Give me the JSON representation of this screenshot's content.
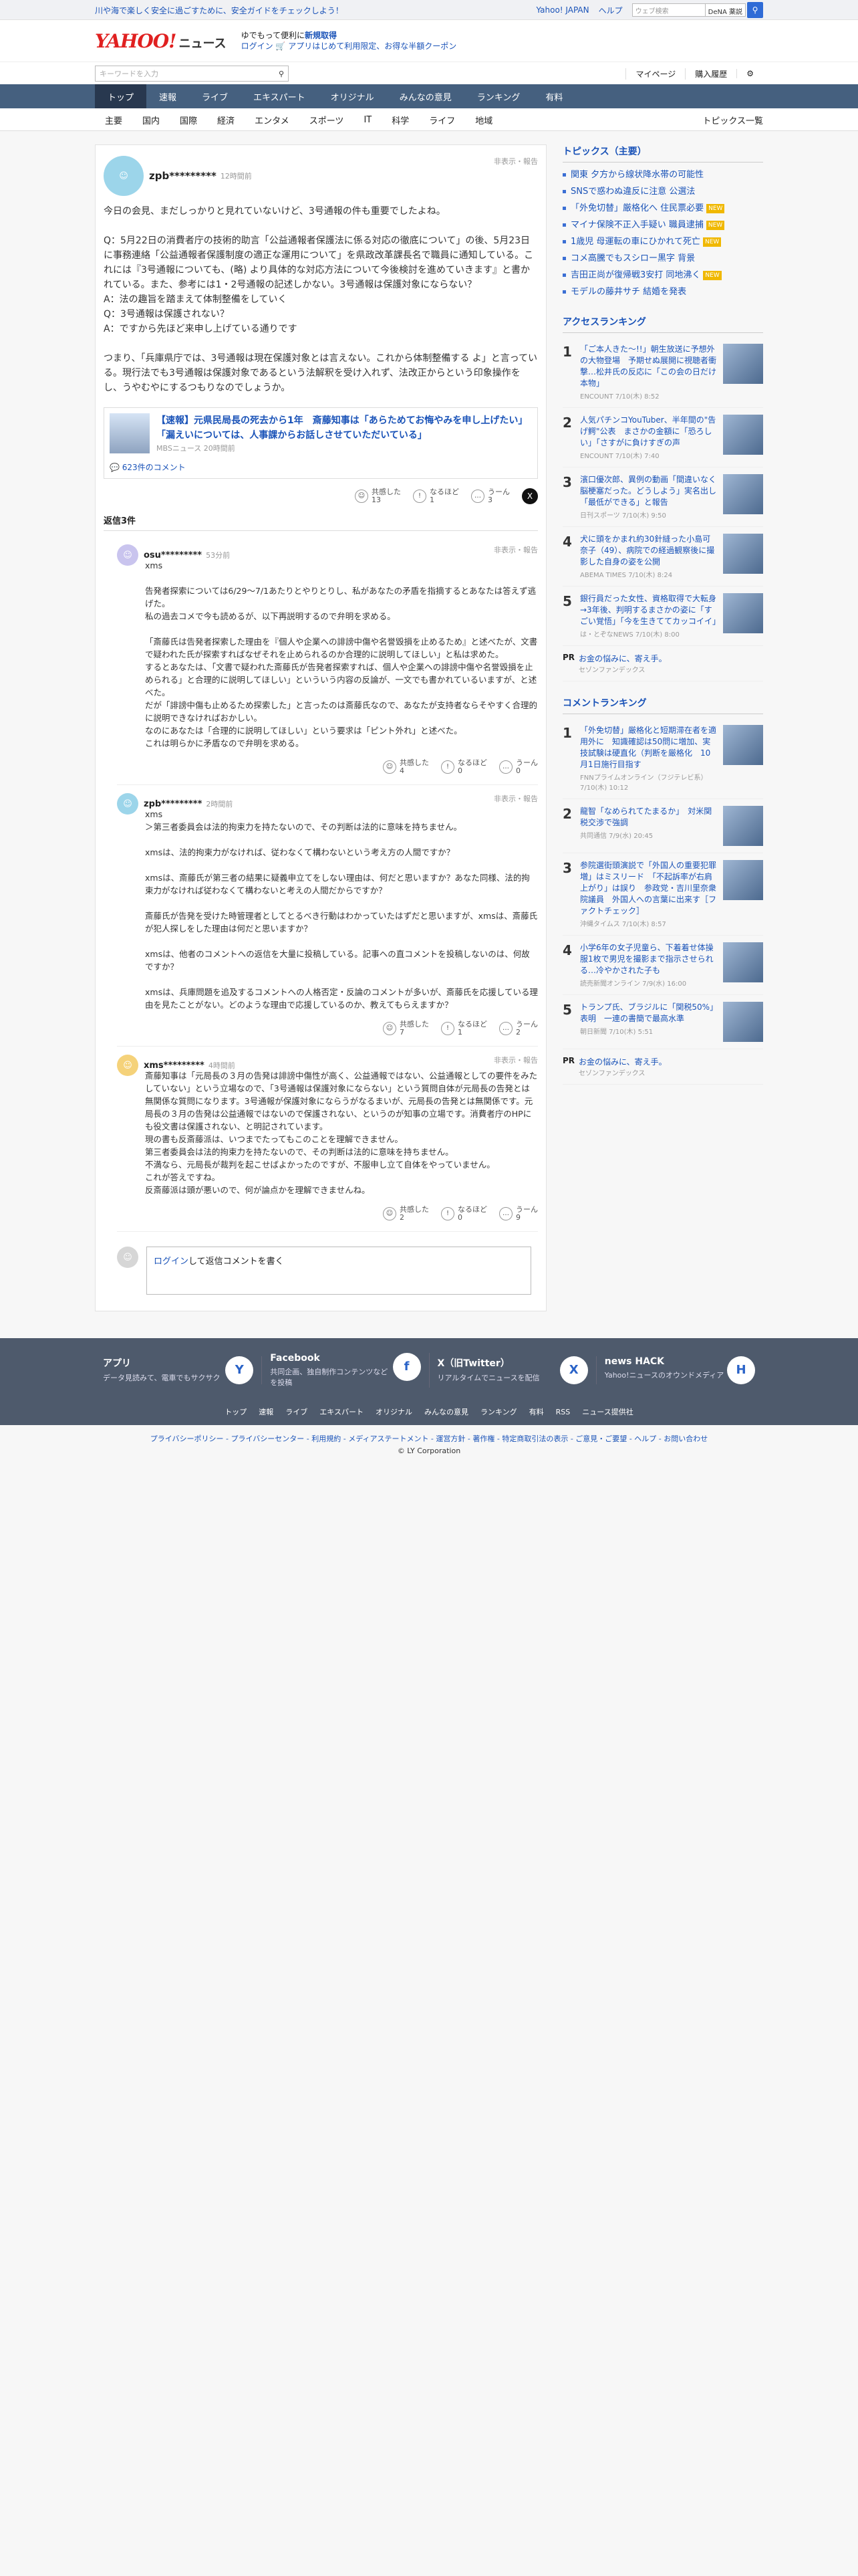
{
  "topstrip": {
    "notice": "川や海で楽しく安全に過ごすために、安全ガイドをチェックしよう！",
    "links": [
      "Yahoo! JAPAN",
      "ヘルプ"
    ],
    "search_placeholder": "ウェブ検索",
    "dena": "DeNA 薬説"
  },
  "header": {
    "logo_yahoo": "YAHOO!",
    "logo_japan": "JAPAN",
    "logo_news": "ニュース",
    "promo1": "ゆでもって便利に",
    "promo1_bold": "新規取得",
    "promo2": "ログイン",
    "promo3": "アプリはじめて利用限定、お得な半額クーポン"
  },
  "search": {
    "placeholder": "キーワードを入力",
    "mypage": "マイページ",
    "history": "購入履歴"
  },
  "gnav": [
    "トップ",
    "速報",
    "ライブ",
    "エキスパート",
    "オリジナル",
    "みんなの意見",
    "ランキング",
    "有料"
  ],
  "snav": [
    "主要",
    "国内",
    "国際",
    "経済",
    "エンタメ",
    "スポーツ",
    "IT",
    "科学",
    "ライフ",
    "地域"
  ],
  "snav_all": "トピックス一覧",
  "comment": {
    "user": "zpb*********",
    "time": "12時間前",
    "report": "非表示・報告",
    "text": "今日の会見、まだしっかりと見れていないけど、3号通報の件も重要でしたよね。\n\nQ：5月22日の消費者庁の技術的助言「公益通報者保護法に係る対応の徹底について」の後、5月23日に事務連絡「公益通報者保護制度の適正な運用について」を県政改革課長名で職員に通知している。これには『3号通報についても、(略) より具体的な対応方法について今後検討を進めていきます』と書かれている。また、参考には1・2号通報の記述しかない。3号通報は保護対象にならない？\nA：法の趣旨を踏まえて体制整備をしていく\nQ：3号通報は保護されない？\nA：ですから先ほど来申し上げている通りです\n\nつまり、「兵庫県庁では、3号通報は現在保護対象とは言えない。これから体制整備する よ」と言っている。現行法でも3号通報は保護対象であるという法解釈を受け入れず、法改正からという印象操作をし、うやむやにするつもりなのでしょうか。",
    "article_title": "【速報】元県民局長の死去から1年　斎藤知事は「あらためてお悔やみを申し上げたい」「漏えいについては、人事課からお話しさせていただいている」",
    "article_meta": "MBSニュース 20時間前",
    "article_comments": "623件のコメント",
    "reacts": {
      "empathy_label": "共感した",
      "empathy": "13",
      "naruhodo_label": "なるほど",
      "naruhodo": "1",
      "uun_label": "うーん",
      "uun": "3"
    }
  },
  "replies_label": "返信3件",
  "replies": [
    {
      "user": "osu*********",
      "time": "53分前",
      "report": "非表示・報告",
      "text": "xms\n\n告発者探索については6/29〜7/1あたりとやりとりし、私があなたの矛盾を指摘するとあなたは答えず逃げた。\n私の過去コメで今も読めるが、以下再説明するので弁明を求める。\n\n「斎藤氏は告発者探索した理由を『個人や企業への誹謗中傷や名誉毀損を止めるため』と述べたが、文書で疑われた氏が探索すればなぜそれを止められるのか合理的に説明してほしい」と私は求めた。\nするとあなたは、「文書で疑われた斎藤氏が告発者探索すれば、個人や企業への誹謗中傷や名誉毀損を止められる」と合理的に説明してほしい」といういう内容の反論が、一文でも書かれているいますが、と述べた。\nだが「誹謗中傷も止めるため探索した」と言ったのは斎藤氏なので、あなたが支持者ならそやすく合理的に説明できなければおかしい。\nなのにあなたは「合理的に説明してほしい」という要求は「ピント外れ」と述べた。\nこれは明らかに矛盾なので弁明を求める。",
      "empathy": "4",
      "naruhodo": "0",
      "uun": "0"
    },
    {
      "user": "zpb*********",
      "time": "2時間前",
      "report": "非表示・報告",
      "text": "xms\n＞第三者委員会は法的拘束力を持たないので、その判断は法的に意味を持ちません。\n\nxmsは、法的拘束力がなければ、従わなくて構わないという考え方の人間ですか？\n\nxmsは、斎藤氏が第三者の結果に疑義申立てをしない理由は、何だと思いますか？あなた同様、法的拘束力がなければ従わなくて構わないと考えの人間だからですか？\n\n斎藤氏が告発を受けた時管理者としてとるべき行動はわかっていたはずだと思いますが、xmsは、斎藤氏が犯人探しをした理由は何だと思いますか？\n\nxmsは、他者のコメントへの返信を大量に投稿している。記事への直コメントを投稿しないのは、何故ですか？\n\nxmsは、兵庫問題を追及するコメントへの人格否定・反論のコメントが多いが、斎藤氏を応援している理由を見たことがない。どのような理由で応援しているのか、教えてもらえますか？",
      "empathy": "7",
      "naruhodo": "1",
      "uun": "2"
    },
    {
      "user": "xms*********",
      "time": "4時間前",
      "report": "非表示・報告",
      "text": "斎藤知事は「元局長の３月の告発は誹謗中傷性が高く、公益通報ではない、公益通報としての要件をみたしていない」という立場なので、「3号通報は保護対象にならない」という質問自体が元局長の告発とは無関係な質問になります。3号通報が保護対象にならうがなるまいが、元局長の告発とは無関係です。元局長の３月の告発は公益通報ではないので保護されない、というのが知事の立場です。消費者庁のHPにも役文書は保護されない、と明記されています。\n現の書も反斎藤派は、いつまでたってもこのことを理解できません。\n第三者委員会は法的拘束力を持たないので、その判断は法的に意味を持ちません。\n不満なら、元局長が裁判を起こせばよかったのですが、不服申し立て自体をやっていません。\nこれが答えですね。\n反斎藤派は頭が悪いので、何が論点かを理解できませんね。",
      "empathy": "2",
      "naruhodo": "0",
      "uun": "9"
    }
  ],
  "login": {
    "link": "ログイン",
    "rest": "して返信コメントを書く"
  },
  "topics": {
    "title": "トピックス（主要）",
    "items": [
      {
        "t": "関東 夕方から線状降水帯の可能性",
        "b": ""
      },
      {
        "t": "SNSで惑わぬ違反に注意 公選法",
        "b": ""
      },
      {
        "t": "「外免切替」厳格化へ 住民票必要",
        "b": "NEW"
      },
      {
        "t": "マイナ保険不正入手疑い 職員逮捕",
        "b": "NEW"
      },
      {
        "t": "1歳児 母運転の車にひかれて死亡",
        "b": "NEW"
      },
      {
        "t": "コメ高騰でもスシロー黒字 背景",
        "b": ""
      },
      {
        "t": "吉田正尚が復帰戦3安打 同地沸く",
        "b": "NEW"
      },
      {
        "t": "モデルの藤井サチ 結婚を発表",
        "b": ""
      }
    ]
  },
  "access": {
    "title": "アクセスランキング",
    "items": [
      {
        "n": "1",
        "t": "「ご本人きた〜!!」朝生放送に予想外の大物登場　予期せぬ展開に視聴者衝撃…松井氏の反応に「この会の日だけ本物」",
        "m": "ENCOUNT 7/10(木) 8:52"
      },
      {
        "n": "2",
        "t": "人気パチンコYouTuber、半年間の\"告げ鰐\"公表　まさかの金額に「恐ろしい」「さすがに負けすぎの声",
        "m": "ENCOUNT 7/10(木) 7:40"
      },
      {
        "n": "3",
        "t": "濱口優次郎、異例の動画「間違いなく脳梗塞だった。どうしよう」実名出し「最低ができる」と報告",
        "m": "日刊スポーツ 7/10(木) 9:50"
      },
      {
        "n": "4",
        "t": "犬に頭をかまれ約30針縫った小島可奈子（49）、病院での経過観察後に撮影した自身の姿を公開",
        "m": "ABEMA TIMES 7/10(木) 8:24"
      },
      {
        "n": "5",
        "t": "銀行員だった女性、資格取得で大転身→3年後、判明するまさかの姿に「すごい覚悟」「今を生きててカッコイイ」",
        "m": "は・とぞなNEWS 7/10(木) 8:00"
      }
    ]
  },
  "pr": {
    "tag": "PR",
    "title": "お金の悩みに、寄え手。",
    "sub": "セゾンファンデックス"
  },
  "commentrank": {
    "title": "コメントランキング",
    "items": [
      {
        "n": "1",
        "t": "「外免切替」厳格化と短期滞在者を適用外に　知識確認は50問に増加、実技試験は硬直化（判断を厳格化　10月1日施行目指す",
        "m": "FNNプライムオンライン（フジテレビ系） 7/10(木) 10:12"
      },
      {
        "n": "2",
        "t": "龍智「なめられてたまるか」　対米関税交渉で強調",
        "m": "共同通信 7/9(水) 20:45"
      },
      {
        "n": "3",
        "t": "参院選街頭演説で「外国人の重要犯罪増」はミスリード　「不起訴率が右肩上がり」は誤り　参政党・吉川里奈衆院議員　外国人への言葉に出来す［ファクトチェック］",
        "m": "沖縄タイムス 7/10(木) 8:57"
      },
      {
        "n": "4",
        "t": "小学6年の女子児童ら、下着着せ体操服1枚で男児を撮影まで指示させられる…冷やかされた子も",
        "m": "読売新聞オンライン 7/9(水) 16:00"
      },
      {
        "n": "5",
        "t": "トランプ氏、ブラジルに「関税50%」表明　一連の書簡で最高水準",
        "m": "朝日新聞 7/10(木) 5:51"
      }
    ]
  },
  "footer": {
    "boxes": [
      {
        "t": "アプリ",
        "d": "データ見読みて、電車でもサクサク",
        "icon": "Y"
      },
      {
        "t": "Facebook",
        "d": "共同企画、独自制作コンテンツなどを投稿",
        "icon": "f"
      },
      {
        "t": "X（旧Twitter）",
        "d": "リアルタイムでニュースを配信",
        "icon": "X"
      },
      {
        "t": "news HACK",
        "d": "Yahoo!ニュースのオウンドメディア",
        "icon": "H"
      }
    ],
    "links": [
      "トップ",
      "速報",
      "ライブ",
      "エキスパート",
      "オリジナル",
      "みんなの意見",
      "ランキング",
      "有料",
      "RSS",
      "ニュース提供社"
    ],
    "bottom": "プライバシーポリシー - プライバシーセンター - 利用規約 - メディアステートメント - 運営方針 - 著作権 - 特定商取引法の表示 - ご意見・ご要望 - ヘルプ - お問い合わせ",
    "copy": "© LY Corporation"
  }
}
